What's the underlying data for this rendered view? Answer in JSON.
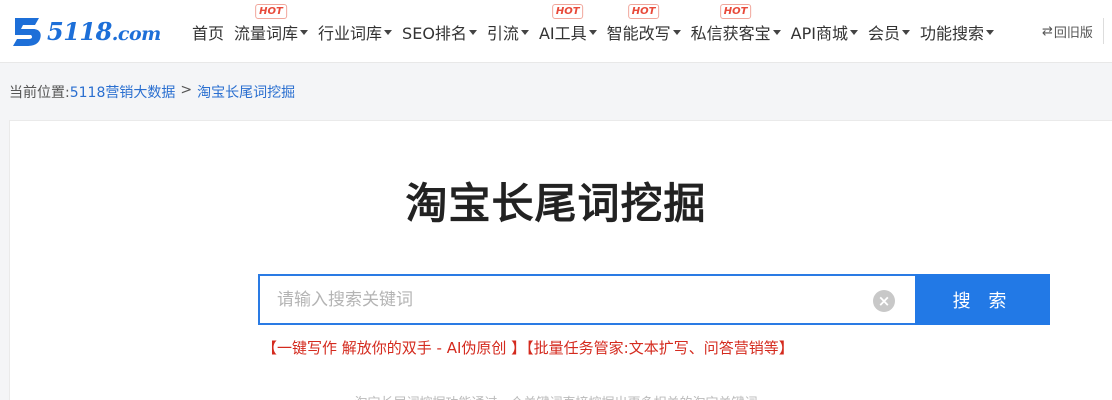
{
  "logo": {
    "text": "5118",
    "domain": ".com",
    "brand_color": "#1d6fd8"
  },
  "nav": {
    "items": [
      {
        "label": "首页",
        "dropdown": false,
        "hot": false
      },
      {
        "label": "流量词库",
        "dropdown": true,
        "hot": true
      },
      {
        "label": "行业词库",
        "dropdown": true,
        "hot": false
      },
      {
        "label": "SEO排名",
        "dropdown": true,
        "hot": false
      },
      {
        "label": "引流",
        "dropdown": true,
        "hot": false
      },
      {
        "label": "AI工具",
        "dropdown": true,
        "hot": true
      },
      {
        "label": "智能改写",
        "dropdown": true,
        "hot": true
      },
      {
        "label": "私信获客宝",
        "dropdown": true,
        "hot": true
      },
      {
        "label": "API商城",
        "dropdown": true,
        "hot": false
      },
      {
        "label": "会员",
        "dropdown": true,
        "hot": false
      },
      {
        "label": "功能搜索",
        "dropdown": true,
        "hot": false
      }
    ],
    "hot_label": "HOT",
    "back_old_label": "回旧版",
    "back_old_icon": "swap-arrows-icon"
  },
  "breadcrumb": {
    "prefix": "当前位置:",
    "links": [
      "5118营销大数据",
      "淘宝长尾词挖掘"
    ],
    "separator": ">"
  },
  "main": {
    "title": "淘宝长尾词挖掘",
    "search": {
      "placeholder": "请输入搜索关键词",
      "value": "",
      "button_label": "搜 索",
      "accent_color": "#2279e6"
    },
    "promo": {
      "part1": "【一键写作 解放你的双手 - AI伪原创 】",
      "part2": "【批量任务管家:文本扩写、问答营销等】"
    },
    "description": "淘宝长尾词挖掘功能通过一个关键词直接挖掘出更多相关的淘宝关键词"
  }
}
